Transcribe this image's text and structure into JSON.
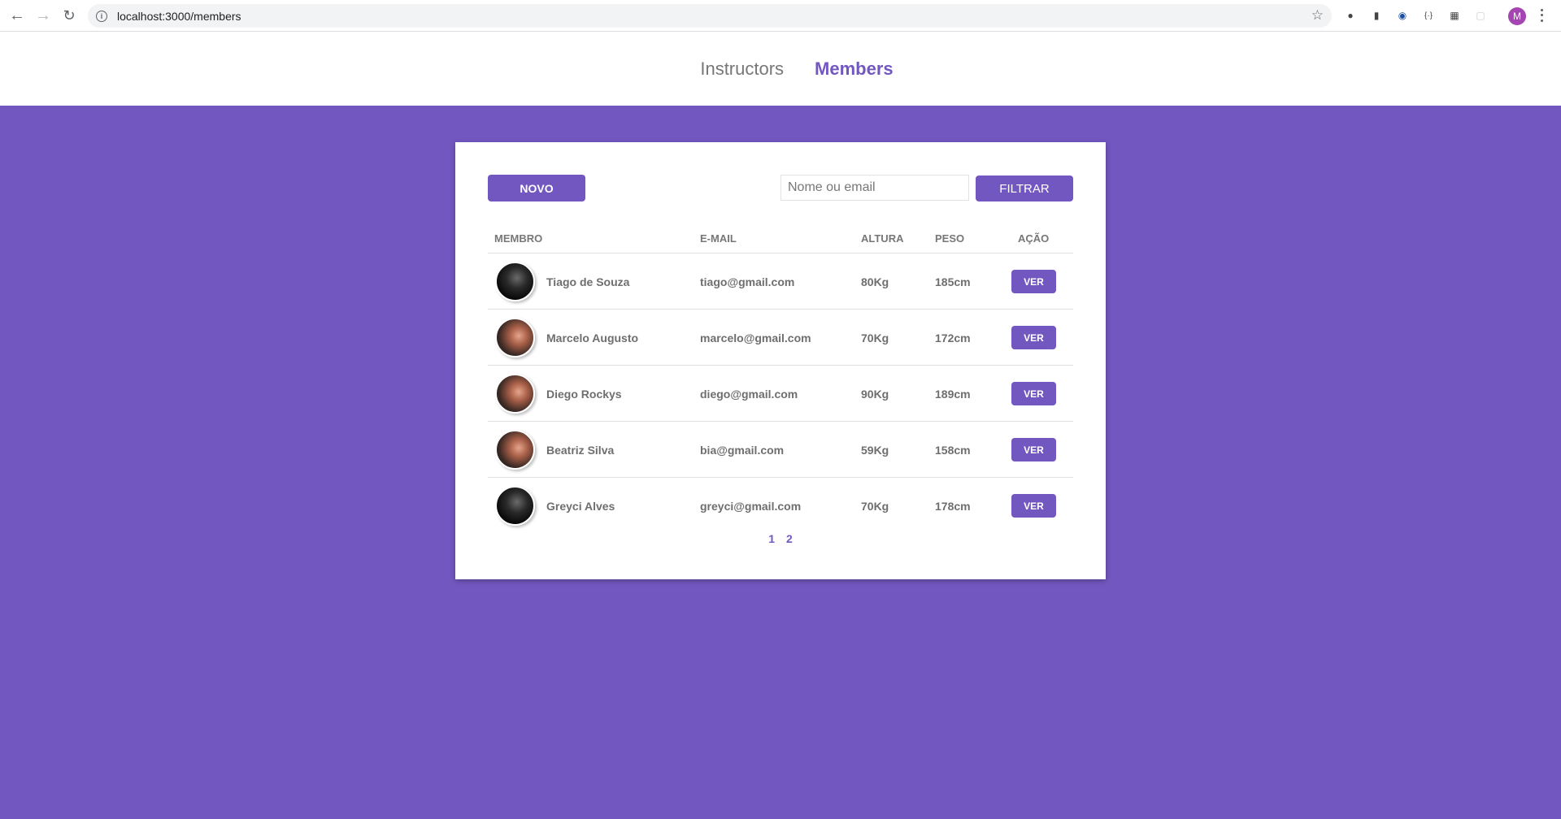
{
  "browser": {
    "url": "localhost:3000/members",
    "profile_initial": "M"
  },
  "nav": {
    "instructors": "Instructors",
    "members": "Members"
  },
  "toolbar": {
    "new_label": "NOVO",
    "search_placeholder": "Nome ou email",
    "filter_label": "FILTRAR"
  },
  "table": {
    "headers": [
      "MEMBRO",
      "E-MAIL",
      "ALTURA",
      "PESO",
      "AÇÃO"
    ],
    "rows": [
      {
        "name": "Tiago de Souza",
        "email": "tiago@gmail.com",
        "altura": "80Kg",
        "peso": "185cm",
        "action": "VER",
        "avatar": "dark"
      },
      {
        "name": "Marcelo Augusto",
        "email": "marcelo@gmail.com",
        "altura": "70Kg",
        "peso": "172cm",
        "action": "VER",
        "avatar": "warm"
      },
      {
        "name": "Diego Rockys",
        "email": "diego@gmail.com",
        "altura": "90Kg",
        "peso": "189cm",
        "action": "VER",
        "avatar": "warm"
      },
      {
        "name": "Beatriz Silva",
        "email": "bia@gmail.com",
        "altura": "59Kg",
        "peso": "158cm",
        "action": "VER",
        "avatar": "warm"
      },
      {
        "name": "Greyci Alves",
        "email": "greyci@gmail.com",
        "altura": "70Kg",
        "peso": "178cm",
        "action": "VER",
        "avatar": "dark"
      }
    ]
  },
  "pagination": [
    "1",
    "2"
  ],
  "colors": {
    "accent": "#7357c0",
    "background": "#7357c0",
    "card": "#ffffff",
    "text_muted": "#777777"
  }
}
